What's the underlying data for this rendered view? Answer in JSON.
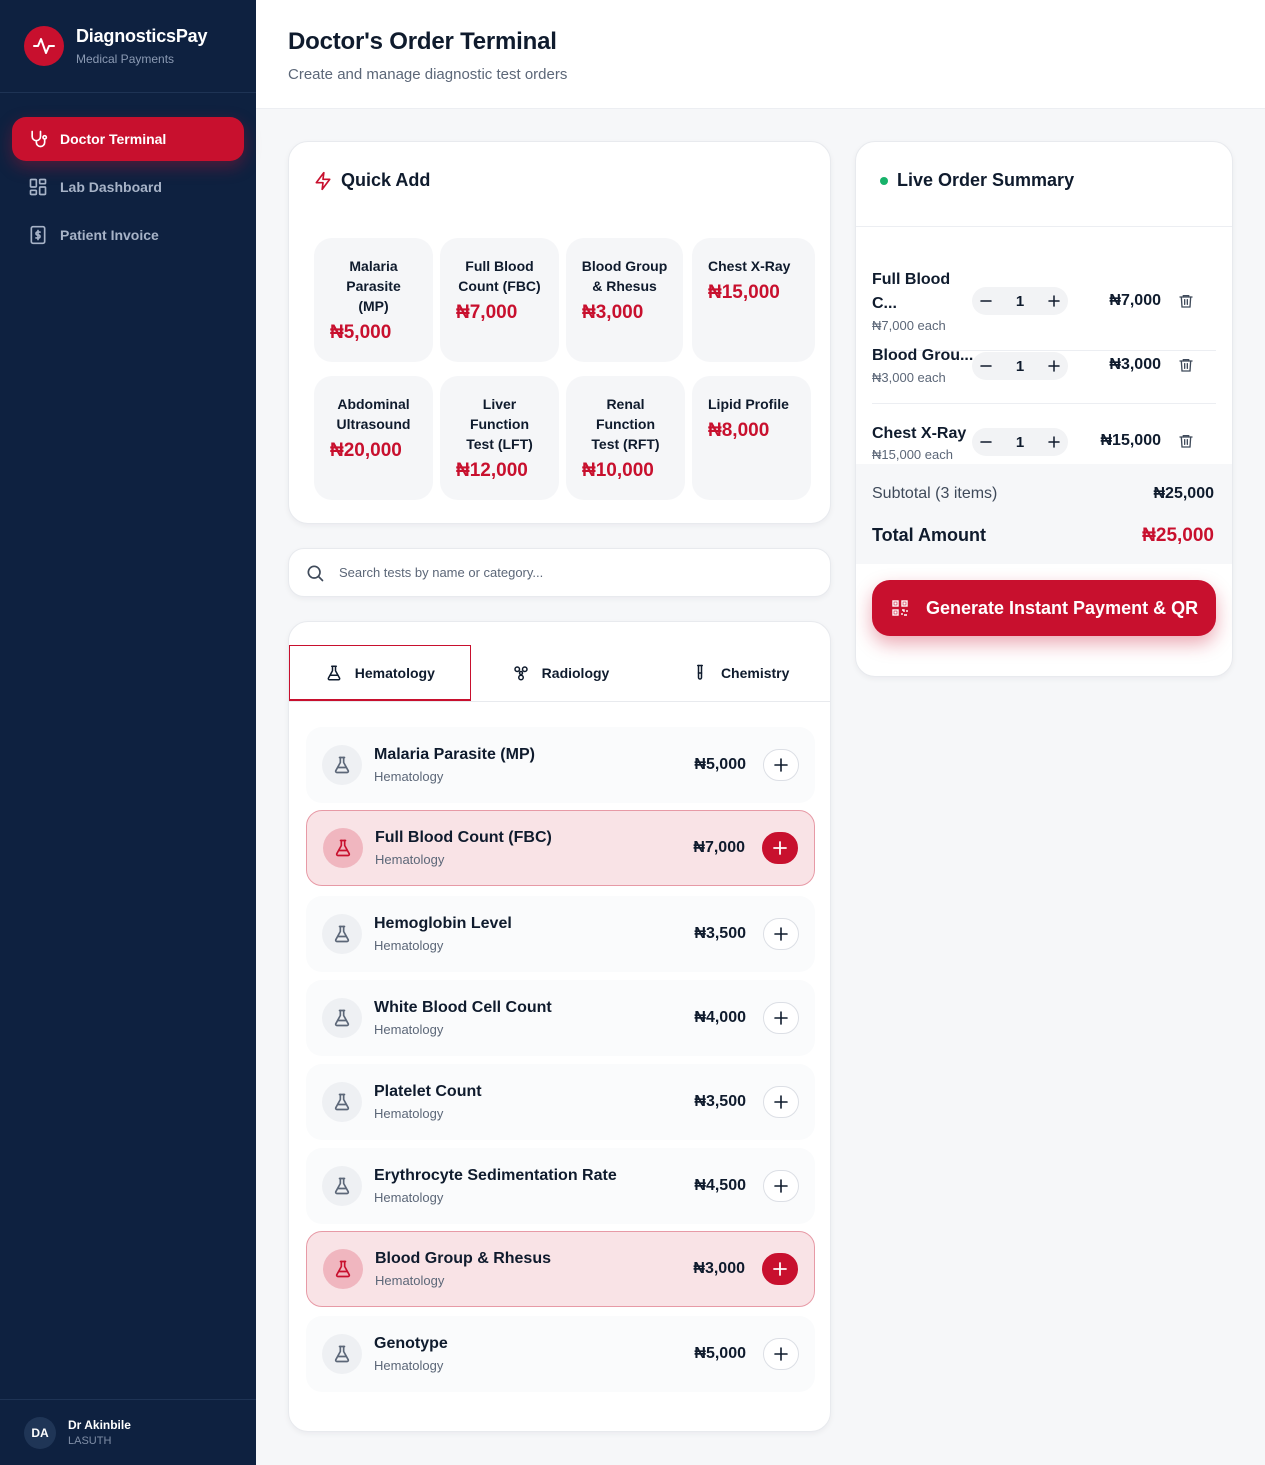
{
  "brand": {
    "name": "DiagnosticsPay",
    "subtitle": "Medical Payments",
    "accent": "#c8102e"
  },
  "nav": {
    "items": [
      {
        "label": "Doctor Terminal",
        "icon": "stethoscope-icon",
        "active": true
      },
      {
        "label": "Lab Dashboard",
        "icon": "grid-icon",
        "active": false
      },
      {
        "label": "Patient Invoice",
        "icon": "invoice-icon",
        "active": false
      }
    ]
  },
  "user": {
    "initials": "DA",
    "name": "Dr Akinbile",
    "org": "LASUTH"
  },
  "header": {
    "title": "Doctor's Order Terminal",
    "subtitle": "Create and manage diagnostic test orders"
  },
  "quick_add": {
    "title": "Quick Add",
    "icon": "lightning-icon",
    "tiles": [
      {
        "name": "Malaria Parasite (MP)",
        "price": "₦5,000"
      },
      {
        "name": "Full Blood Count (FBC)",
        "price": "₦7,000"
      },
      {
        "name": "Blood Group & Rhesus",
        "price": "₦3,000"
      },
      {
        "name": "Chest X-Ray",
        "price": "₦15,000"
      },
      {
        "name": "Abdominal Ultrasound",
        "price": "₦20,000"
      },
      {
        "name": "Liver Function Test (LFT)",
        "price": "₦12,000"
      },
      {
        "name": "Renal Function Test (RFT)",
        "price": "₦10,000"
      },
      {
        "name": "Lipid Profile",
        "price": "₦8,000"
      }
    ]
  },
  "search": {
    "placeholder": "Search tests by name or category..."
  },
  "tabs": [
    {
      "label": "Hematology",
      "icon": "flask-icon",
      "active": true
    },
    {
      "label": "Radiology",
      "icon": "radiation-icon",
      "active": false
    },
    {
      "label": "Chemistry",
      "icon": "test-tube-icon",
      "active": false
    }
  ],
  "tests": [
    {
      "name": "Malaria Parasite (MP)",
      "category": "Hematology",
      "price": "₦5,000",
      "selected": false
    },
    {
      "name": "Full Blood Count (FBC)",
      "category": "Hematology",
      "price": "₦7,000",
      "selected": true
    },
    {
      "name": "Hemoglobin Level",
      "category": "Hematology",
      "price": "₦3,500",
      "selected": false
    },
    {
      "name": "White Blood Cell Count",
      "category": "Hematology",
      "price": "₦4,000",
      "selected": false
    },
    {
      "name": "Platelet Count",
      "category": "Hematology",
      "price": "₦3,500",
      "selected": false
    },
    {
      "name": "Erythrocyte Sedimentation Rate",
      "category": "Hematology",
      "price": "₦4,500",
      "selected": false
    },
    {
      "name": "Blood Group & Rhesus",
      "category": "Hematology",
      "price": "₦3,000",
      "selected": true
    },
    {
      "name": "Genotype",
      "category": "Hematology",
      "price": "₦5,000",
      "selected": false
    }
  ],
  "summary": {
    "title": "Live Order Summary",
    "status_color": "#17b26a",
    "items": [
      {
        "name": "Full Blood C...",
        "each": "₦7,000 each",
        "qty": "1",
        "total": "₦7,000"
      },
      {
        "name": "Blood Grou...",
        "each": "₦3,000 each",
        "qty": "1",
        "total": "₦3,000"
      },
      {
        "name": "Chest X-Ray",
        "each": "₦15,000 each",
        "qty": "1",
        "total": "₦15,000"
      }
    ],
    "subtotal_label": "Subtotal (3 items)",
    "subtotal": "₦25,000",
    "total_label": "Total Amount",
    "total": "₦25,000",
    "button_label": "Generate Instant Payment & QR"
  }
}
